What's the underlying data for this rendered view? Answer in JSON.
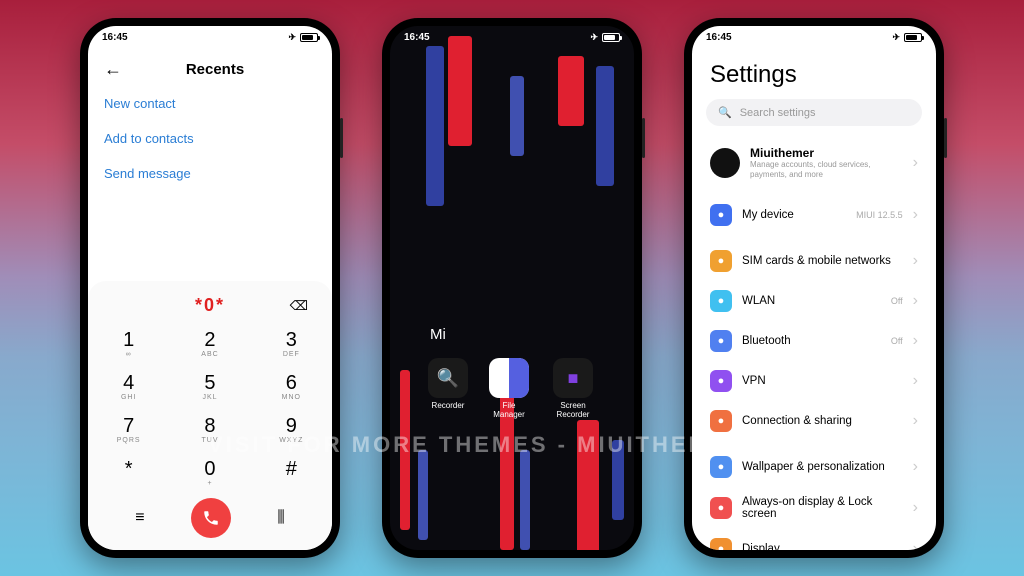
{
  "status": {
    "time": "16:45"
  },
  "watermark": "VISIT FOR MORE THEMES - MIUITHEMER.COM",
  "dialer": {
    "title": "Recents",
    "links": [
      "New contact",
      "Add to contacts",
      "Send message"
    ],
    "input": "*0*",
    "keys": [
      {
        "num": "1",
        "sub": "∞"
      },
      {
        "num": "2",
        "sub": "ABC"
      },
      {
        "num": "3",
        "sub": "DEF"
      },
      {
        "num": "4",
        "sub": "GHI"
      },
      {
        "num": "5",
        "sub": "JKL"
      },
      {
        "num": "6",
        "sub": "MNO"
      },
      {
        "num": "7",
        "sub": "PQRS"
      },
      {
        "num": "8",
        "sub": "TUV"
      },
      {
        "num": "9",
        "sub": "WXYZ"
      },
      {
        "num": "*",
        "sub": " "
      },
      {
        "num": "0",
        "sub": "+"
      },
      {
        "num": "#",
        "sub": " "
      }
    ]
  },
  "home": {
    "folder": "Mi",
    "apps": [
      {
        "label": "Recorder",
        "icon": "rec",
        "glyph": "🔍"
      },
      {
        "label": "File Manager",
        "icon": "fm",
        "glyph": ""
      },
      {
        "label": "Screen Recorder",
        "icon": "sr",
        "glyph": "■"
      }
    ]
  },
  "settings": {
    "title": "Settings",
    "search_placeholder": "Search settings",
    "account": {
      "name": "Miuithemer",
      "sub": "Manage accounts, cloud services, payments, and more"
    },
    "items": [
      {
        "icon": "i-device",
        "label": "My device",
        "value": "MIUI 12.5.5"
      },
      {
        "icon": "i-sim",
        "label": "SIM cards & mobile networks",
        "value": ""
      },
      {
        "icon": "i-wlan",
        "label": "WLAN",
        "value": "Off"
      },
      {
        "icon": "i-bt",
        "label": "Bluetooth",
        "value": "Off"
      },
      {
        "icon": "i-vpn",
        "label": "VPN",
        "value": ""
      },
      {
        "icon": "i-conn",
        "label": "Connection & sharing",
        "value": ""
      },
      {
        "icon": "i-wall",
        "label": "Wallpaper & personalization",
        "value": ""
      },
      {
        "icon": "i-aod",
        "label": "Always-on display & Lock screen",
        "value": ""
      },
      {
        "icon": "i-disp",
        "label": "Display",
        "value": ""
      }
    ]
  }
}
